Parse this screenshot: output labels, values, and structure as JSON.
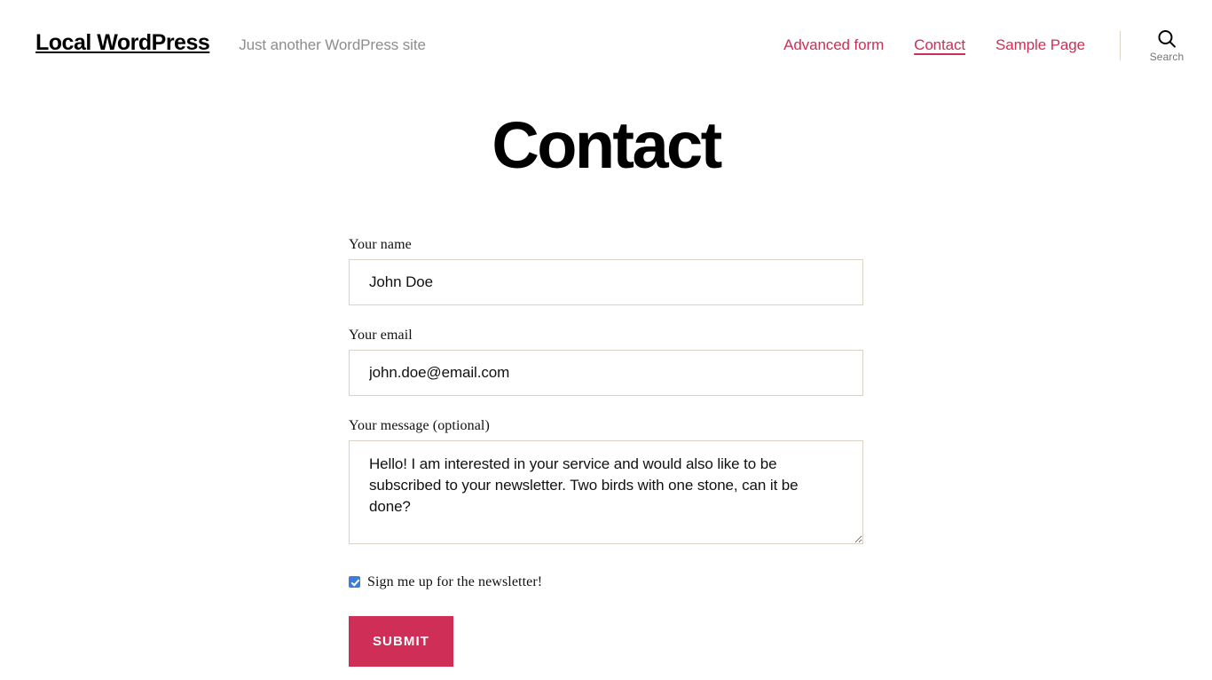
{
  "header": {
    "site_title": "Local WordPress",
    "tagline": "Just another WordPress site",
    "nav": [
      {
        "label": "Advanced form",
        "current": false
      },
      {
        "label": "Contact",
        "current": true
      },
      {
        "label": "Sample Page",
        "current": false
      }
    ],
    "search": {
      "icon": "search-icon",
      "label": "Search"
    },
    "colors": {
      "link": "#cf2e56",
      "tagline": "#8d8d8d",
      "divider": "#ddd5c7"
    }
  },
  "page": {
    "title": "Contact"
  },
  "form": {
    "name_field": {
      "label": "Your name",
      "value": "John Doe",
      "placeholder": ""
    },
    "email_field": {
      "label": "Your email",
      "value": "john.doe@email.com",
      "placeholder": ""
    },
    "message_field": {
      "label": "Your message (optional)",
      "value": "Hello! I am interested in your service and would also like to be subscribed to your newsletter. Two birds with one stone, can it be done?",
      "placeholder": ""
    },
    "newsletter_checkbox": {
      "label": "Sign me up for the newsletter!",
      "checked": true,
      "color": "#3b7ddd"
    },
    "submit": {
      "label": "Submit",
      "color": "#cf2e56"
    },
    "colors": {
      "input_border": "#d9d2c5",
      "text": "#111111"
    }
  }
}
